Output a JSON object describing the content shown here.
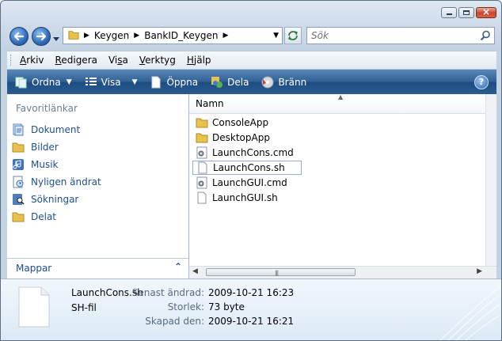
{
  "window": {
    "caption_close": "×"
  },
  "address": {
    "crumbs": [
      "Keygen",
      "BankID_Keygen"
    ]
  },
  "search": {
    "placeholder": "Sök"
  },
  "menu": {
    "items": [
      {
        "u": "A",
        "rest": "rkiv"
      },
      {
        "u": "R",
        "rest": "edigera"
      },
      {
        "pre": "Vi",
        "u": "s",
        "rest": "a"
      },
      {
        "u": "V",
        "rest": "erktyg"
      },
      {
        "u": "H",
        "rest": "jälp"
      }
    ]
  },
  "commands": {
    "organize": "Ordna",
    "views": "Visa",
    "open": "Öppna",
    "share": "Dela",
    "burn": "Bränn",
    "help": "?"
  },
  "favorites": {
    "title": "Favoritlänkar",
    "items": [
      "Dokument",
      "Bilder",
      "Musik",
      "Nyligen ändrat",
      "Sökningar",
      "Delat"
    ],
    "folders_label": "Mappar"
  },
  "filelist": {
    "column": "Namn",
    "files": [
      {
        "name": "ConsoleApp",
        "icon": "folder-icon"
      },
      {
        "name": "DesktopApp",
        "icon": "folder-icon"
      },
      {
        "name": "LaunchCons.cmd",
        "icon": "cmd-file-icon"
      },
      {
        "name": "LaunchCons.sh",
        "icon": "file-icon",
        "selected": true
      },
      {
        "name": "LaunchGUI.cmd",
        "icon": "cmd-file-icon"
      },
      {
        "name": "LaunchGUI.sh",
        "icon": "file-icon"
      }
    ]
  },
  "details": {
    "name": "LaunchCons.sh",
    "type": "SH-fil",
    "modified_label": "Senast ändrad:",
    "modified": "2009-10-21 16:23",
    "size_label": "Storlek:",
    "size": "73 byte",
    "created_label": "Skapad den:",
    "created": "2009-10-21 16:21"
  }
}
